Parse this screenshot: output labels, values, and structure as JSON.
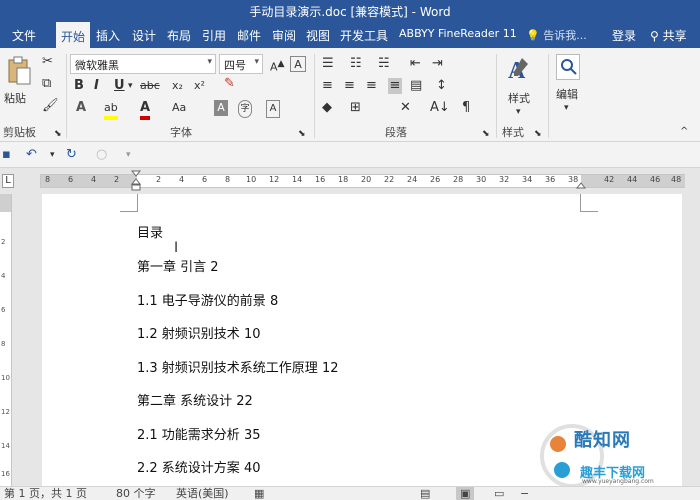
{
  "window": {
    "title": "手动目录演示.doc [兼容模式] - Word"
  },
  "tabs": [
    {
      "label": "文件"
    },
    {
      "label": "开始"
    },
    {
      "label": "插入"
    },
    {
      "label": "设计"
    },
    {
      "label": "布局"
    },
    {
      "label": "引用"
    },
    {
      "label": "邮件"
    },
    {
      "label": "审阅"
    },
    {
      "label": "视图"
    },
    {
      "label": "开发工具"
    },
    {
      "label": "ABBYY FineReader 11"
    }
  ],
  "tellme": {
    "placeholder": "告诉我..."
  },
  "account": {
    "login": "登录",
    "share": "共享"
  },
  "ribbon": {
    "paste_label": "粘贴",
    "clipboard_label": "剪贴板",
    "font_name": "微软雅黑",
    "font_size": "四号",
    "font_group_label": "字体",
    "paragraph_group_label": "段落",
    "style_group_label": "样式",
    "styles_button": "样式",
    "edit_button": "编辑",
    "bold": "B",
    "italic": "I",
    "underline": "U",
    "strike": "abc",
    "subscript": "x₂",
    "superscript": "x²",
    "font_color": "A",
    "highlight": "ab",
    "font_case": "Aa"
  },
  "ruler": {
    "left_ticks": [
      "8",
      "6",
      "4",
      "2"
    ],
    "right_ticks": [
      "2",
      "4",
      "6",
      "8",
      "10",
      "12",
      "14",
      "16",
      "18",
      "20",
      "22",
      "24",
      "26",
      "28",
      "30",
      "32",
      "34",
      "36",
      "38"
    ],
    "far_ticks": [
      "42",
      "44",
      "46",
      "48"
    ]
  },
  "vruler": [
    "2",
    "4",
    "6",
    "8",
    "10",
    "12",
    "14",
    "16"
  ],
  "document": {
    "lines": [
      "目录",
      "第一章  引言 2",
      "1.1  电子导游仪的前景 8",
      "1.2  射频识别技术 10",
      "1.3  射频识别技术系统工作原理 12",
      "第二章  系统设计 22",
      "2.1  功能需求分析 35",
      "2.2  系统设计方案 40"
    ]
  },
  "watermark": {
    "brand": "酷知网",
    "brand2": "趣丰下载网",
    "url": "www.yueyangbang.com"
  },
  "status": {
    "page": "第 1 页，共 1 页",
    "words": "80 个字",
    "language": "英语(美国)"
  },
  "colors": {
    "accent": "#2b579a",
    "ribbon": "#f3f3f3"
  }
}
